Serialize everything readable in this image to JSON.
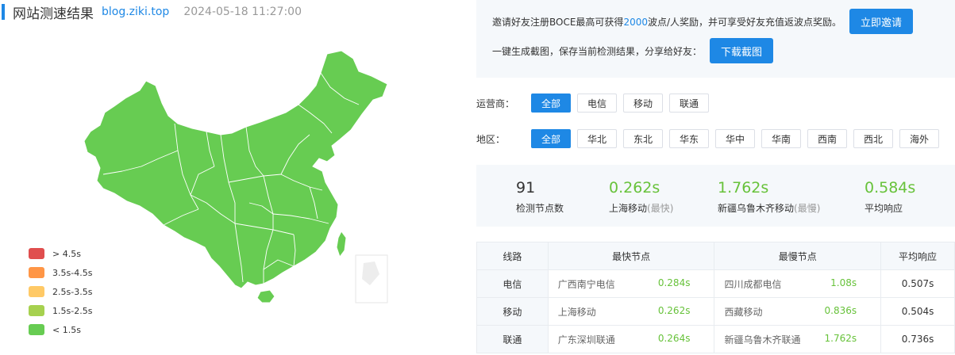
{
  "header": {
    "title": "网站测速结果",
    "domain": "blog.ziki.top",
    "time": "2024-05-18 11:27:00"
  },
  "legend": [
    {
      "label": "> 4.5s",
      "color": "#e04e4e"
    },
    {
      "label": "3.5s-4.5s",
      "color": "#ff9646"
    },
    {
      "label": "2.5s-3.5s",
      "color": "#ffc966"
    },
    {
      "label": "1.5s-2.5s",
      "color": "#a6d14f"
    },
    {
      "label": "< 1.5s",
      "color": "#67cc52"
    }
  ],
  "map": {
    "fill_color": "#67cc52",
    "border_color": "#ffffff"
  },
  "invite": {
    "text1_a": "邀请好友注册BOCE最高可获得",
    "text1_highlight": "2000",
    "text1_b": "波点/人奖励，并可享受好友充值返波点奖励。",
    "invite_button": "立即邀请",
    "text2": "一键生成截图，保存当前检测结果，分享给好友：",
    "screenshot_button": "下载截图"
  },
  "filters": {
    "carrier_label": "运营商：",
    "carriers": [
      "全部",
      "电信",
      "移动",
      "联通"
    ],
    "region_label": "地区：",
    "regions": [
      "全部",
      "华北",
      "东北",
      "华东",
      "华中",
      "华南",
      "西南",
      "西北",
      "海外"
    ]
  },
  "summary": {
    "nodes_value": "91",
    "nodes_label": "检测节点数",
    "fastest_value": "0.262s",
    "fastest_label": "上海移动",
    "fastest_tag": "(最快)",
    "slowest_value": "1.762s",
    "slowest_label": "新疆乌鲁木齐移动",
    "slowest_tag": "(最慢)",
    "avg_value": "0.584s",
    "avg_label": "平均响应"
  },
  "table": {
    "headers": [
      "线路",
      "最快节点",
      "最慢节点",
      "平均响应"
    ],
    "rows": [
      {
        "line": "电信",
        "fast_name": "广西南宁电信",
        "fast_time": "0.284s",
        "slow_name": "四川成都电信",
        "slow_time": "1.08s",
        "avg": "0.507s"
      },
      {
        "line": "移动",
        "fast_name": "上海移动",
        "fast_time": "0.262s",
        "slow_name": "西藏移动",
        "slow_time": "0.836s",
        "avg": "0.504s"
      },
      {
        "line": "联通",
        "fast_name": "广东深圳联通",
        "fast_time": "0.264s",
        "slow_name": "新疆乌鲁木齐联通",
        "slow_time": "1.762s",
        "avg": "0.736s"
      }
    ]
  }
}
